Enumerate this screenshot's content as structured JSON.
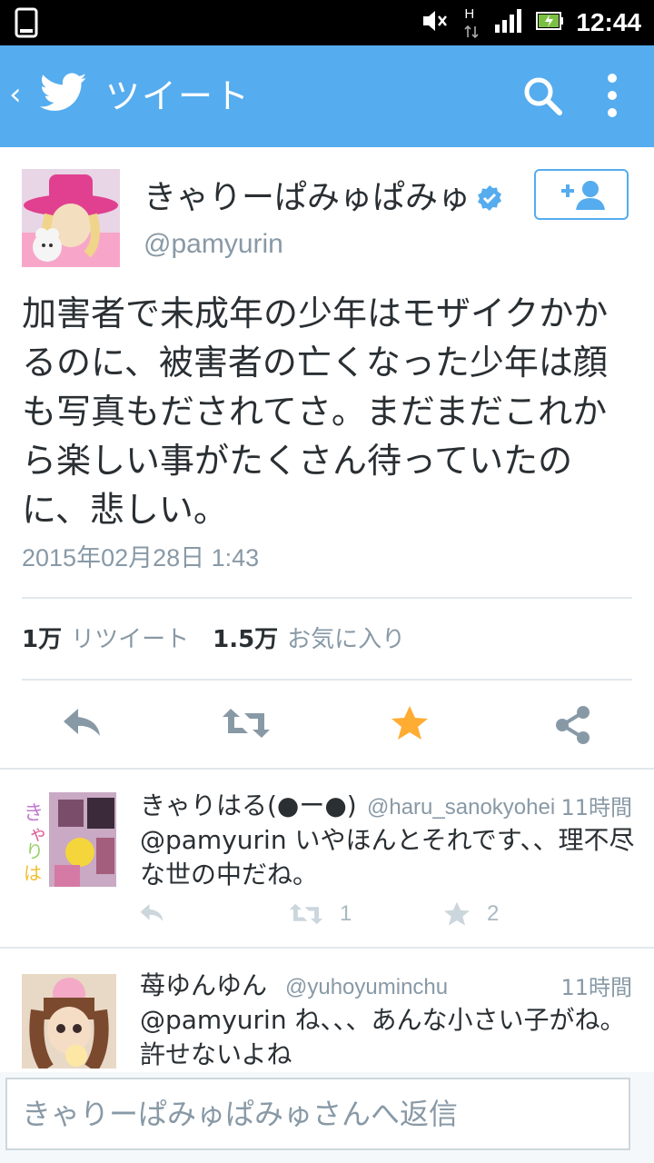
{
  "status_bar": {
    "time": "12:44",
    "network_label": "H"
  },
  "app_bar": {
    "title": "ツイート",
    "icons": [
      "back-icon",
      "twitter-bird-icon",
      "search-icon",
      "more-icon"
    ],
    "color": "#55acee"
  },
  "tweet": {
    "author_name": "きゃりーぱみゅぱみゅ",
    "author_handle": "@pamyurin",
    "text": "加害者で未成年の少年はモザイクかかるのに、被害者の亡くなった少年は顔も写真もだされてさ。まだまだこれから楽しい事がたくさん待っていたのに、悲しい。",
    "date": "2015年02月28日 1:43",
    "retweets_count": "1万",
    "retweets_label": "リツイート",
    "favorites_count": "1.5万",
    "favorites_label": "お気に入り",
    "favorited": true
  },
  "replies": [
    {
      "name": "きゃりはる(●ー●)",
      "handle": "@haru_sanokyohei",
      "time": "11時間",
      "mention": "@pamyurin",
      "text": " いやほんとそれです、、理不尽な世の中だね。",
      "retweet_count": "1",
      "favorite_count": "2",
      "avatar_text": "きゃりはる"
    },
    {
      "name": "苺ゆんゆん",
      "handle": "@yuhoyuminchu",
      "time": "11時間",
      "mention": "@pamyurin",
      "text": " ね、、、あんな小さい子がね。許せないよね"
    }
  ],
  "reply_box": {
    "placeholder": "きゃりーぱみゅぱみゅさんへ返信"
  }
}
